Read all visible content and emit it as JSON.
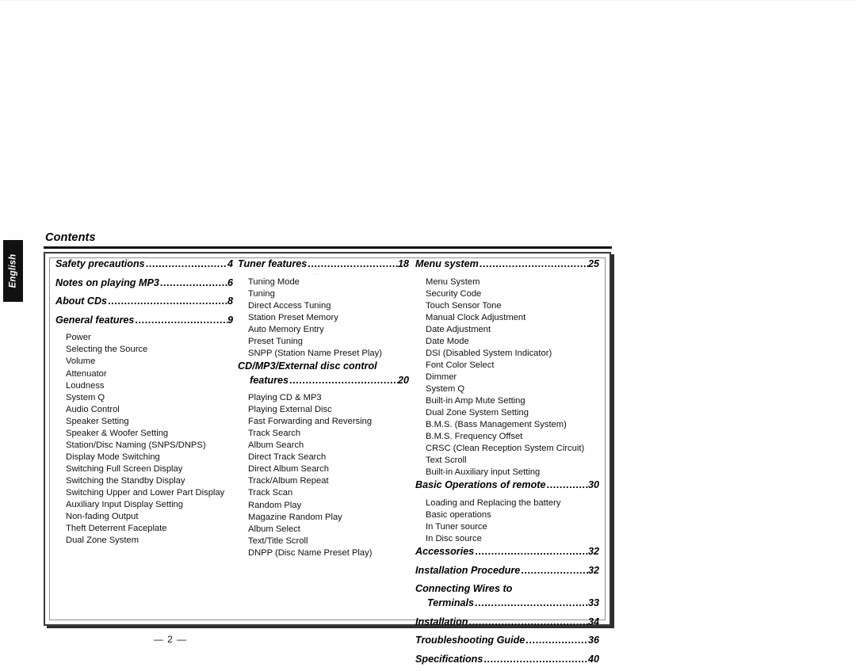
{
  "document": {
    "language_tab": "English",
    "section_title": "Contents",
    "page_marker": "— 2 —",
    "colors": {
      "tab_background": "#111111",
      "tab_text": "#ffffff",
      "rule": "#111111",
      "frame_border": "#3a3a3a",
      "frame_inner_border": "#8f8f8f",
      "text": "#000000",
      "paper": "#ffffff"
    }
  },
  "columns": [
    {
      "id": "column-1",
      "entries": [
        {
          "type": "major",
          "label": "Safety precautions",
          "page": "4"
        },
        {
          "type": "major",
          "label": "Notes on playing MP3 ",
          "page": "6"
        },
        {
          "type": "major",
          "label": "About CDs",
          "page": "8"
        },
        {
          "type": "major",
          "label": "General features ",
          "page": "9"
        },
        {
          "type": "minor",
          "label": "Power"
        },
        {
          "type": "minor",
          "label": "Selecting the Source"
        },
        {
          "type": "minor",
          "label": "Volume"
        },
        {
          "type": "minor",
          "label": "Attenuator"
        },
        {
          "type": "minor",
          "label": "Loudness"
        },
        {
          "type": "minor",
          "label": "System Q"
        },
        {
          "type": "minor",
          "label": "Audio Control"
        },
        {
          "type": "minor",
          "label": "Speaker Setting"
        },
        {
          "type": "minor",
          "label": "Speaker & Woofer Setting"
        },
        {
          "type": "minor",
          "label": "Station/Disc Naming (SNPS/DNPS)"
        },
        {
          "type": "minor",
          "label": "Display Mode Switching"
        },
        {
          "type": "minor",
          "label": "Switching Full Screen Display"
        },
        {
          "type": "minor",
          "label": "Switching the Standby Display"
        },
        {
          "type": "minor",
          "label": "Switching Upper and Lower Part Display"
        },
        {
          "type": "minor",
          "label": "Auxiliary Input Display Setting"
        },
        {
          "type": "minor",
          "label": "Non-fading Output"
        },
        {
          "type": "minor",
          "label": "Theft Deterrent Faceplate"
        },
        {
          "type": "minor",
          "label": "Dual Zone System"
        }
      ]
    },
    {
      "id": "column-2",
      "entries": [
        {
          "type": "major",
          "label": "Tuner features",
          "page": "18"
        },
        {
          "type": "minor",
          "label": "Tuning Mode"
        },
        {
          "type": "minor",
          "label": "Tuning"
        },
        {
          "type": "minor",
          "label": "Direct Access Tuning"
        },
        {
          "type": "minor",
          "label": "Station Preset Memory"
        },
        {
          "type": "minor",
          "label": "Auto Memory Entry"
        },
        {
          "type": "minor",
          "label": "Preset Tuning"
        },
        {
          "type": "minor",
          "label": "SNPP (Station Name Preset Play)"
        },
        {
          "type": "major-wrap",
          "label_line1": "CD/MP3/External disc control",
          "label_line2": "features ",
          "page": "20"
        },
        {
          "type": "minor",
          "label": "Playing CD & MP3"
        },
        {
          "type": "minor",
          "label": "Playing External Disc"
        },
        {
          "type": "minor",
          "label": "Fast Forwarding and Reversing"
        },
        {
          "type": "minor",
          "label": "Track Search"
        },
        {
          "type": "minor",
          "label": "Album Search"
        },
        {
          "type": "minor",
          "label": "Direct Track Search"
        },
        {
          "type": "minor",
          "label": "Direct Album Search"
        },
        {
          "type": "minor",
          "label": "Track/Album Repeat"
        },
        {
          "type": "minor",
          "label": "Track Scan"
        },
        {
          "type": "minor",
          "label": "Random Play"
        },
        {
          "type": "minor",
          "label": "Magazine Random Play"
        },
        {
          "type": "minor",
          "label": "Album Select"
        },
        {
          "type": "minor",
          "label": "Text/Title Scroll"
        },
        {
          "type": "minor",
          "label": "DNPP (Disc Name Preset Play)"
        }
      ]
    },
    {
      "id": "column-3",
      "entries": [
        {
          "type": "major",
          "label": "Menu system",
          "page": "25"
        },
        {
          "type": "minor",
          "label": "Menu System"
        },
        {
          "type": "minor",
          "label": "Security Code"
        },
        {
          "type": "minor",
          "label": "Touch Sensor Tone"
        },
        {
          "type": "minor",
          "label": "Manual Clock Adjustment"
        },
        {
          "type": "minor",
          "label": "Date Adjustment"
        },
        {
          "type": "minor",
          "label": "Date Mode"
        },
        {
          "type": "minor",
          "label": "DSI (Disabled System Indicator)"
        },
        {
          "type": "minor",
          "label": "Font Color Select"
        },
        {
          "type": "minor",
          "label": "Dimmer"
        },
        {
          "type": "minor",
          "label": "System Q"
        },
        {
          "type": "minor",
          "label": "Built-in Amp Mute Setting"
        },
        {
          "type": "minor",
          "label": "Dual Zone System Setting"
        },
        {
          "type": "minor",
          "label": "B.M.S. (Bass Management System)"
        },
        {
          "type": "minor",
          "label": "B.M.S. Frequency Offset"
        },
        {
          "type": "minor",
          "label": "CRSC (Clean Reception System Circuit)"
        },
        {
          "type": "minor",
          "label": "Text Scroll"
        },
        {
          "type": "minor",
          "label": "Built-in Auxiliary input Setting"
        },
        {
          "type": "major",
          "label": "Basic Operations of remote",
          "page": "30"
        },
        {
          "type": "minor",
          "label": "Loading and Replacing the battery"
        },
        {
          "type": "minor",
          "label": "Basic operations"
        },
        {
          "type": "minor",
          "label": "In Tuner source"
        },
        {
          "type": "minor",
          "label": "In Disc source"
        },
        {
          "type": "major",
          "label": "Accessories",
          "page": "32"
        },
        {
          "type": "major",
          "label": "Installation Procedure ",
          "page": "32"
        },
        {
          "type": "major-wrap",
          "label_line1": "Connecting Wires to",
          "label_line2": "Terminals",
          "page": "33"
        },
        {
          "type": "major",
          "label": "Installation ",
          "page": "34"
        },
        {
          "type": "major",
          "label": "Troubleshooting Guide ",
          "page": "36"
        },
        {
          "type": "major",
          "label": "Specifications ",
          "page": "40"
        }
      ]
    }
  ]
}
